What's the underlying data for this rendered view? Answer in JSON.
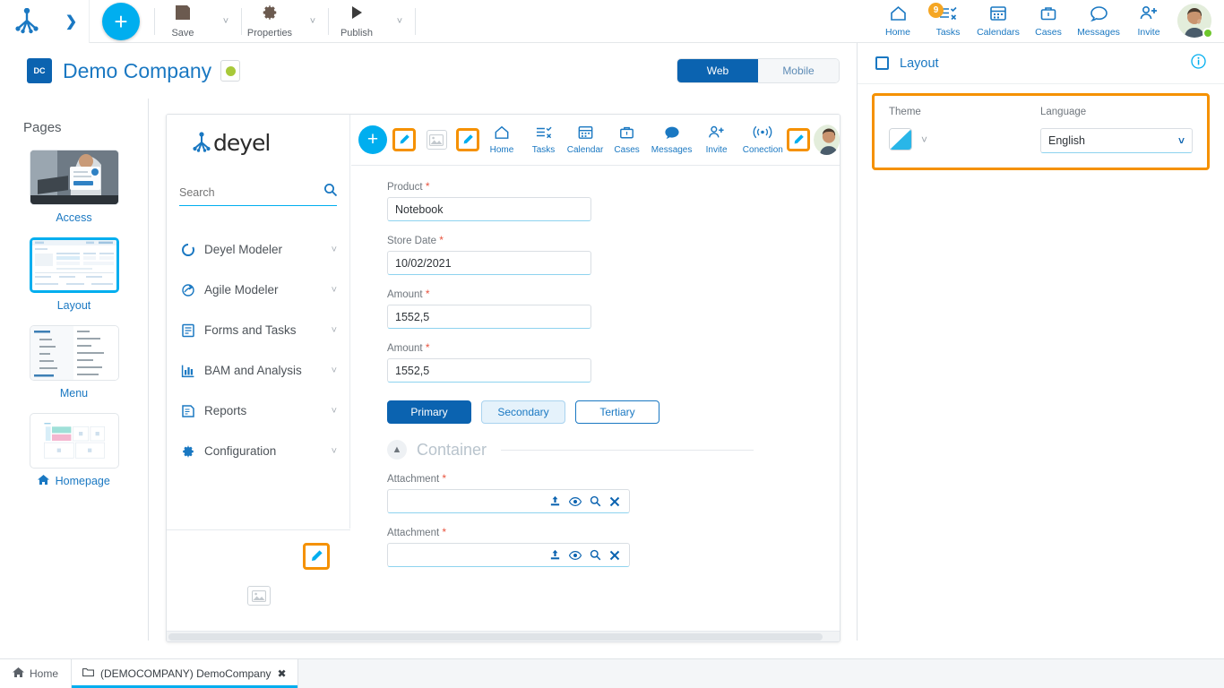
{
  "toolbar": {
    "logo_icon": "deyel-logo-icon",
    "expand_icon": "chevron-right-icon",
    "add_label": "+",
    "items": [
      {
        "label": "Save",
        "icon": "save-icon"
      },
      {
        "label": "Properties",
        "icon": "gear-icon"
      },
      {
        "label": "Publish",
        "icon": "play-icon"
      }
    ],
    "right_items": [
      {
        "label": "Home",
        "icon": "home-icon",
        "badge": ""
      },
      {
        "label": "Tasks",
        "icon": "tasks-icon",
        "badge": "9"
      },
      {
        "label": "Calendars",
        "icon": "calendar-icon",
        "badge": ""
      },
      {
        "label": "Cases",
        "icon": "briefcase-icon",
        "badge": ""
      },
      {
        "label": "Messages",
        "icon": "message-icon",
        "badge": ""
      },
      {
        "label": "Invite",
        "icon": "invite-icon",
        "badge": ""
      }
    ]
  },
  "header": {
    "initials": "DC",
    "company": "Demo Company",
    "status": "active",
    "view_web": "Web",
    "view_mobile": "Mobile",
    "selected_view": "Web"
  },
  "pages": {
    "title": "Pages",
    "items": [
      {
        "label": "Access",
        "selected": false,
        "icon": ""
      },
      {
        "label": "Layout",
        "selected": true,
        "icon": ""
      },
      {
        "label": "Menu",
        "selected": false,
        "icon": ""
      },
      {
        "label": "Homepage",
        "selected": false,
        "icon": "home-icon"
      }
    ]
  },
  "preview": {
    "logo_text": "deyel",
    "search_placeholder": "Search",
    "search_value": "",
    "menu": [
      {
        "label": "Deyel Modeler",
        "icon": "circle-arrow-icon"
      },
      {
        "label": "Agile Modeler",
        "icon": "agile-icon"
      },
      {
        "label": "Forms and Tasks",
        "icon": "form-icon"
      },
      {
        "label": "BAM and Analysis",
        "icon": "chart-bars-icon"
      },
      {
        "label": "Reports",
        "icon": "report-icon"
      },
      {
        "label": "Configuration",
        "icon": "gear-icon"
      }
    ],
    "topnav": [
      {
        "label": "Home",
        "icon": "home-icon"
      },
      {
        "label": "Tasks",
        "icon": "tasks-icon"
      },
      {
        "label": "Calendar",
        "icon": "calendar-icon"
      },
      {
        "label": "Cases",
        "icon": "briefcase-icon"
      },
      {
        "label": "Messages",
        "icon": "message-icon"
      },
      {
        "label": "Invite",
        "icon": "invite-icon"
      },
      {
        "label": "Conection",
        "icon": "connection-icon"
      }
    ],
    "add_label": "+",
    "form": {
      "fields": [
        {
          "label": "Product",
          "required": "*",
          "value": "Notebook"
        },
        {
          "label": "Store Date",
          "required": "*",
          "value": "10/02/2021"
        },
        {
          "label": "Amount",
          "required": "*",
          "value": "1552,5"
        },
        {
          "label": "Amount",
          "required": "*",
          "value": "1552,5"
        }
      ],
      "buttons": [
        {
          "label": "Primary",
          "style": "primary"
        },
        {
          "label": "Secondary",
          "style": "secondary"
        },
        {
          "label": "Tertiary",
          "style": "tertiary"
        }
      ],
      "container_title": "Container",
      "attachments": [
        {
          "label": "Attachment",
          "required": "*",
          "value": ""
        },
        {
          "label": "Attachment",
          "required": "*",
          "value": ""
        }
      ],
      "attachment_icons": [
        "upload-icon",
        "eye-icon",
        "search-icon",
        "close-icon"
      ]
    }
  },
  "right_panel": {
    "title": "Layout",
    "checkbox_icon": "square-icon",
    "info_icon": "info-icon",
    "theme_label": "Theme",
    "theme_value": "",
    "language_label": "Language",
    "language_value": "English"
  },
  "taskbar": {
    "home_label": "Home",
    "tab_label": "(DEMOCOMPANY) DemoCompany",
    "tab_close": "✖"
  },
  "colors": {
    "accent_cyan": "#00aeef",
    "primary_blue": "#0b63b0",
    "link_blue": "#1a78c2",
    "highlight_orange": "#f59100",
    "badge_orange": "#f5a623",
    "status_green": "#a8c93a",
    "required_red": "#e8543f"
  }
}
